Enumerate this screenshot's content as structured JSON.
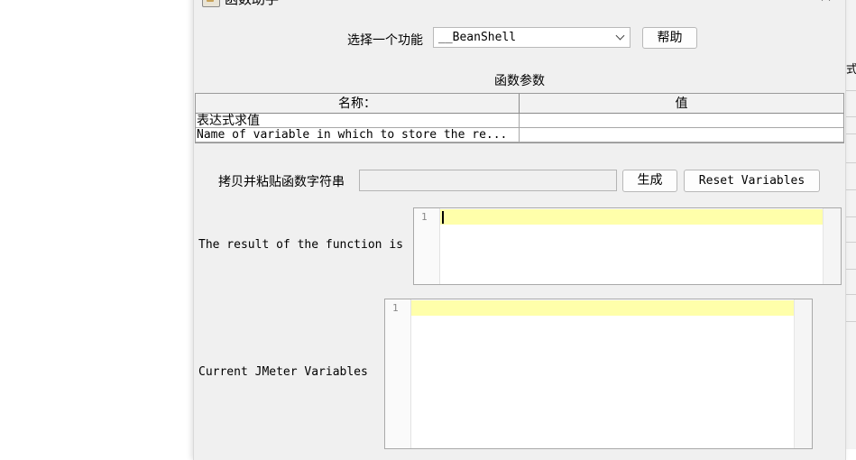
{
  "dialog": {
    "title": "函数助手"
  },
  "function_picker": {
    "label": "选择一个功能",
    "selected": "__BeanShell",
    "help_label": "帮助"
  },
  "params": {
    "title": "函数参数",
    "columns": [
      "名称：",
      "值"
    ],
    "rows": [
      {
        "name": "表达式求值",
        "value": ""
      },
      {
        "name": "Name of variable in which to store the re...",
        "value": ""
      }
    ]
  },
  "copy": {
    "label": "拷贝并粘贴函数字符串",
    "value": "",
    "generate_label": "生成",
    "reset_label": "Reset Variables"
  },
  "result": {
    "label": "The result of the function is",
    "line_number": "1"
  },
  "variables": {
    "label": "Current JMeter Variables",
    "line_number": "1"
  },
  "background": {
    "right_fragment": "式"
  }
}
